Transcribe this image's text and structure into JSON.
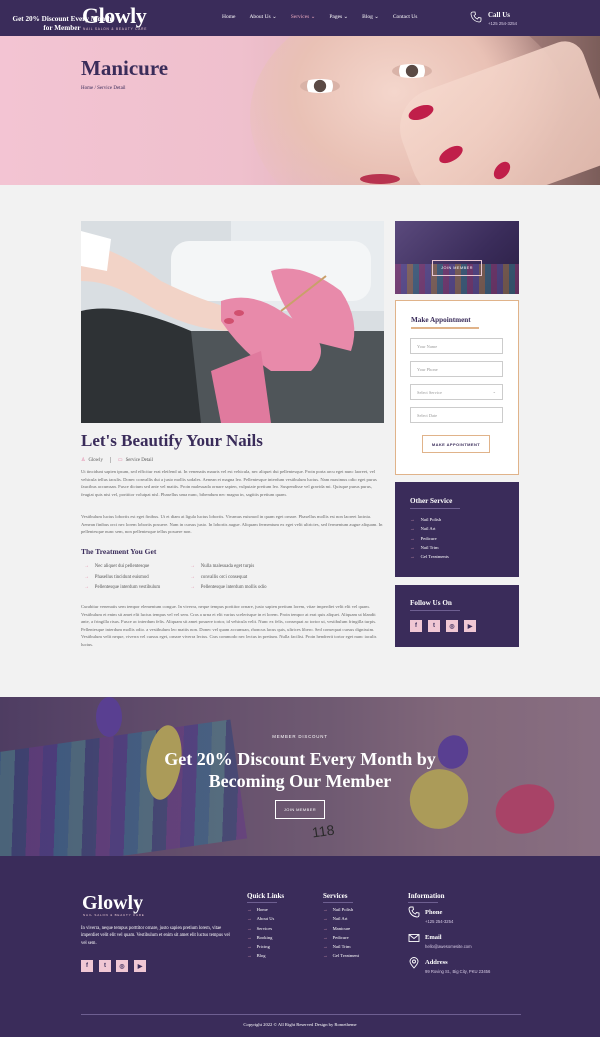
{
  "header": {
    "logo": "Glowly",
    "tagline": "NAIL SALON & BEAUTY CARE",
    "nav": [
      "Home",
      "About Us ⌄",
      "Services ⌄",
      "Pages ⌄",
      "Blog ⌄",
      "Contact Us"
    ],
    "active_nav": "Services",
    "call_title": "Call Us",
    "call_number": "+125 254-3254"
  },
  "banner": {
    "title": "Manicure",
    "breadcrumb": "Home / Service Detail"
  },
  "post": {
    "title": "Let's Beautify Your Nails",
    "author": "Glowly",
    "category": "Service Detail",
    "para1": "Ut tincidunt sapien ipsum, sed efficitur erat eleifend ut. In venenatis mauris vel est vehicula, nec aliquet dui pellentesque. Proin porta arcu eget nunc laoreet, vel vehicula tellus iaculis. Donec convallis dui a justo mollis sodales. Aenean et magna leo. Pellentesque interdum vestibulum luctus. Nam maximus odio eget purus faucibus accumsan. Fusce dictum sed ante vel mattis. Proin malesuada ornare sapien, vulputate pretium leo. Suspendisse vel gravida mi. Quisque purus purus, feugiat quis nisi vel, porttitor volutpat nisl. Phasellus uma nunc, bibendum nec magna in, sagittis pretium quam.",
    "para2": "Vestibulum luctus lobortis est eget finibus. Ut et diam at ligula luctus lobortis. Vivamus euismod in quam eget ornare. Phasellus mollis est non laoreet lacinia. Aenean finibus orci nec lorem lobortis posuere. Nam in cursus justo. In lobortis augue. Aliquam fermentum ex eget velit ultricies, sed fermentum augue aliquam. In pellentesque nunc sem, non pellentesque tellus posuere non.",
    "sub_title": "The Treatment You Get",
    "treatments_left": [
      "Nec aliquet dui pellentesque",
      "Phasellus tincidunt euismod",
      "Pellentesque interdum vestibulum"
    ],
    "treatments_right": [
      "Nulla malesuada eget turpis",
      "convallis orci consequat",
      "Pellentesque interdum mollis odio"
    ],
    "para3": "Curabitur venenatis sem tempor elementum congue. In viverra, neque tempus porttitor ornare, justo sapien pretium lorem, vitae imperdiet velit elit vel quam. Vestibulum et enim sit amet elit luctus tempus vel vel sem. Cras a urna et elit varius scelerisque in et lorem. Proin tempor at erat quis aliquet. Aliquam ut blandit ante, a fringilla risus. Fusce ac interdum felis. Aliquam sit amet posuere tortor, id vehicula velit. Nunc ex felis, consequat ac tortor ut, vestibulum fringilla turpis. Pellentesque interdum mollis odio. a vestibulum leo mattis non. Donec vel quam accumsan, rhoncus lacus quis, ultrices libero. Sed consequat cursus dignissim. Vestibulum velit neque, viverra vel cursus eget, ornare viverra lectus. Cras commodo nec lectus in pretium. Nulla facilisi. Proin hendrerit tortor eget nunc iaculis luctus."
  },
  "sidebar": {
    "promo_title": "Get 20% Discount Every Month for Member",
    "promo_button": "JOIN MEMBER",
    "appointment_title": "Make Appointment",
    "fields": {
      "name": "Your Name",
      "phone": "Your Phone",
      "service": "Select Service",
      "date": "Select Date"
    },
    "appointment_button": "MAKE APPOINTMENT",
    "other_service_title": "Other Service",
    "other_services": [
      "Nail Polish",
      "Nail Art",
      "Pedicure",
      "Nail Trim",
      "Gel Treatments"
    ],
    "follow_title": "Follow Us On",
    "social_icons": [
      "facebook-icon",
      "twitter-icon",
      "instagram-icon",
      "youtube-icon"
    ]
  },
  "discount": {
    "label": "MEMBER DISCOUNT",
    "title": "Get 20% Discount Every Month by Becoming Our Member",
    "button": "JOIN MEMBER",
    "card_number": "118"
  },
  "footer": {
    "logo": "Glowly",
    "tagline": "NAIL SALON & BEAUTY CARE",
    "about": "In viverra, neque tempus porttitor ornare, justo sapien pretium lorem, vitae imperdiet velit elit vel quam. Vestibulum et enim sit amet elit luctus tempus vel vel sem.",
    "quick_links_title": "Quick Links",
    "quick_links": [
      "Home",
      "About Us",
      "Services",
      "Booking",
      "Pricing",
      "Blog"
    ],
    "services_title": "Services",
    "services": [
      "Nail Polish",
      "Nail Art",
      "Manicure",
      "Pedicure",
      "Nail Trim",
      "Gel Treatment"
    ],
    "info_title": "Information",
    "phone_title": "Phone",
    "phone": "+125 254-3254",
    "email_title": "Email",
    "email": "hello@awesomesite.com",
    "address_title": "Address",
    "address": "99 Roving St., Big City, PKU 23456",
    "copyright": "Copyright 2022 © All Right Reserved Design by Rometheme"
  },
  "colors": {
    "primary": "#3a2c5a",
    "accent_pink": "#e7a6bd",
    "accent_gold": "#e0b38a",
    "banner_pink": "#f3c4d3",
    "nail_red": "#c01f4a"
  }
}
